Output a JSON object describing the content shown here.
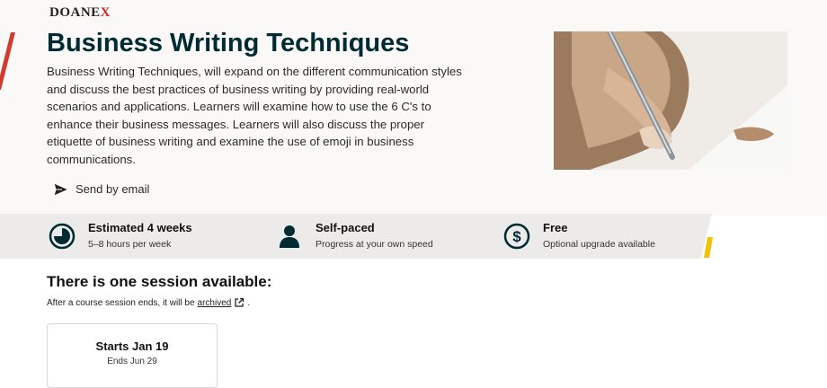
{
  "brand": {
    "logo_prefix": "DOANE",
    "logo_suffix": "X"
  },
  "course": {
    "title": "Business Writing Techniques",
    "description": "Business Writing Techniques, will expand on the different communication styles and discuss the best practices of business writing by providing real-world scenarios and applications. Learners will examine how to use the 6 C's to enhance their business messages. Learners will also discuss the proper etiquette of business writing and examine the use of emoji in business communications.",
    "send_email_label": "Send by email"
  },
  "stats": [
    {
      "icon": "clock-pie-icon",
      "title": "Estimated 4 weeks",
      "subtitle": "5–8 hours per week"
    },
    {
      "icon": "person-icon",
      "title": "Self-paced",
      "subtitle": "Progress at your own speed"
    },
    {
      "icon": "dollar-circle-icon",
      "title": "Free",
      "subtitle": "Optional upgrade available"
    }
  ],
  "sessions": {
    "heading": "There is one session available:",
    "note_prefix": "After a course session ends, it will be",
    "note_link": "archived",
    "note_suffix": ".",
    "cards": [
      {
        "start": "Starts Jan 19",
        "end": "Ends Jun 29"
      }
    ]
  },
  "colors": {
    "title": "#002b34",
    "accent_red": "#d23a2f",
    "accent_yellow": "#f2c200",
    "hero_bg": "#fbf9f8",
    "stats_bg": "#ecebe9"
  }
}
